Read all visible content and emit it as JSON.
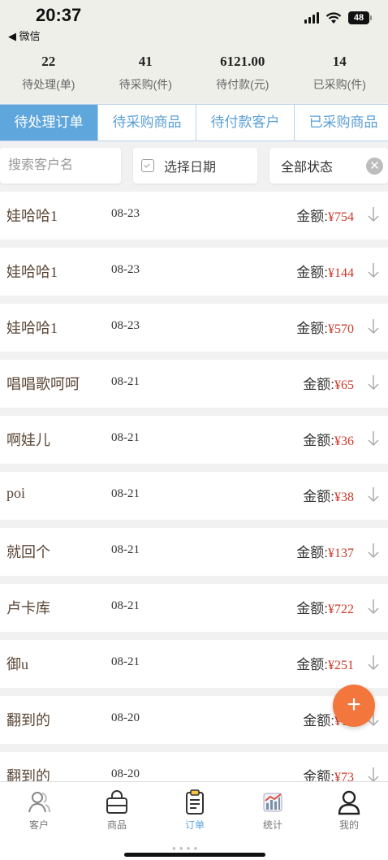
{
  "status": {
    "time": "20:37",
    "back_label": "◀ 微信",
    "battery": "48"
  },
  "stats": [
    {
      "value": "22",
      "label": "待处理(单)"
    },
    {
      "value": "41",
      "label": "待采购(件)"
    },
    {
      "value": "6121.00",
      "label": "待付款(元)"
    },
    {
      "value": "14",
      "label": "已采购(件)"
    }
  ],
  "tabs": [
    {
      "label": "待处理订单",
      "active": true
    },
    {
      "label": "待采购商品",
      "active": false
    },
    {
      "label": "待付款客户",
      "active": false
    },
    {
      "label": "已采购商品",
      "active": false
    }
  ],
  "filters": {
    "search_placeholder": "搜索客户名",
    "date_label": "选择日期",
    "status_value": "全部状态",
    "clear_glyph": "✕"
  },
  "amount_label": "金额:",
  "orders": [
    {
      "customer": "娃哈哈1",
      "date": "08-23",
      "amount": "¥754"
    },
    {
      "customer": "娃哈哈1",
      "date": "08-23",
      "amount": "¥144"
    },
    {
      "customer": "娃哈哈1",
      "date": "08-23",
      "amount": "¥570"
    },
    {
      "customer": "唱唱歌呵呵",
      "date": "08-21",
      "amount": "¥65"
    },
    {
      "customer": "啊娃儿",
      "date": "08-21",
      "amount": "¥36"
    },
    {
      "customer": "poi",
      "date": "08-21",
      "amount": "¥38"
    },
    {
      "customer": "就回个",
      "date": "08-21",
      "amount": "¥137"
    },
    {
      "customer": "卢卡库",
      "date": "08-21",
      "amount": "¥722"
    },
    {
      "customer": "御u",
      "date": "08-21",
      "amount": "¥251"
    },
    {
      "customer": "翻到的",
      "date": "08-20",
      "amount": "¥16"
    },
    {
      "customer": "翻到的",
      "date": "08-20",
      "amount": "¥73"
    }
  ],
  "fab_glyph": "+",
  "tabbar": [
    {
      "label": "客户",
      "icon": "customers-icon",
      "active": false
    },
    {
      "label": "商品",
      "icon": "bag-icon",
      "active": false
    },
    {
      "label": "订单",
      "icon": "orders-icon",
      "active": true
    },
    {
      "label": "统计",
      "icon": "stats-icon",
      "active": false
    },
    {
      "label": "我的",
      "icon": "profile-icon",
      "active": false
    }
  ],
  "colors": {
    "accent": "#5fa6dc",
    "price": "#c93a2a",
    "fab": "#f3773d"
  }
}
